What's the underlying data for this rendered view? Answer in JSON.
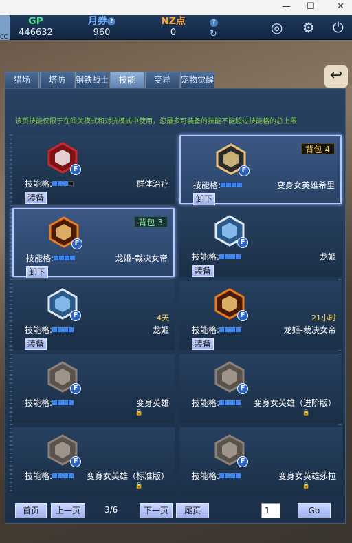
{
  "topbar": {
    "gp_label": "GP",
    "gp_value": "446632",
    "yuequan_label": "月券",
    "yuequan_value": "960",
    "nz_label": "NZ点",
    "nz_value": "0",
    "help_glyph": "?"
  },
  "tabs": [
    "猎场",
    "塔防",
    "钢铁战士",
    "技能",
    "变异",
    "宠物觉醒"
  ],
  "active_tab": "技能",
  "notice": "该页技能仅限于在闯关模式和对抗模式中使用，您最多可装备的技能不能超过技能格的总上限",
  "slot_label": "技能格:",
  "f_badge": "F",
  "skills": [
    {
      "name": "群体治疗",
      "button": "装备",
      "slots": 4,
      "slots_filled": 3,
      "icon": "red-heal-icon"
    },
    {
      "name": "变身女英雄希里",
      "button": "卸下",
      "slots": 4,
      "slots_filled": 4,
      "bag": "背包 4",
      "selected": true,
      "icon": "hero-female-icon"
    },
    {
      "name": "龙姬-裁决女帝",
      "button": "卸下",
      "slots": 4,
      "slots_filled": 4,
      "bag": "背包 3",
      "selected": true,
      "icon": "hero-orange-icon"
    },
    {
      "name": "龙姬",
      "button": "装备",
      "slots": 4,
      "slots_filled": 4,
      "icon": "hero-blue-icon"
    },
    {
      "name": "龙姬",
      "button": "装备",
      "slots": 4,
      "slots_filled": 4,
      "timer": "4天",
      "icon": "hero-blue-icon"
    },
    {
      "name": "龙姬-裁决女帝",
      "button": "装备",
      "slots": 4,
      "slots_filled": 4,
      "timer": "21小时",
      "icon": "hero-orange-icon"
    },
    {
      "name": "变身英雄",
      "slots": 4,
      "slots_filled": 4,
      "locked": true,
      "icon": "hero-locked-icon"
    },
    {
      "name": "变身女英雄（进阶版）",
      "slots": 4,
      "slots_filled": 4,
      "locked": true,
      "icon": "hero-locked-icon"
    },
    {
      "name": "变身女英雄（标准版）",
      "slots": 4,
      "slots_filled": 4,
      "locked": true,
      "icon": "hero-locked-icon"
    },
    {
      "name": "变身女英雄莎拉",
      "slots": 4,
      "slots_filled": 4,
      "locked": true,
      "icon": "hero-locked-icon"
    }
  ],
  "pager": {
    "first": "首页",
    "prev": "上一页",
    "indicator": "3/6",
    "next": "下一页",
    "last": "尾页",
    "page_input": "1",
    "go": "Go"
  },
  "colors": {
    "slot_on": "#3e87f2",
    "notice": "#8ad248",
    "timer": "#ffd34a"
  }
}
